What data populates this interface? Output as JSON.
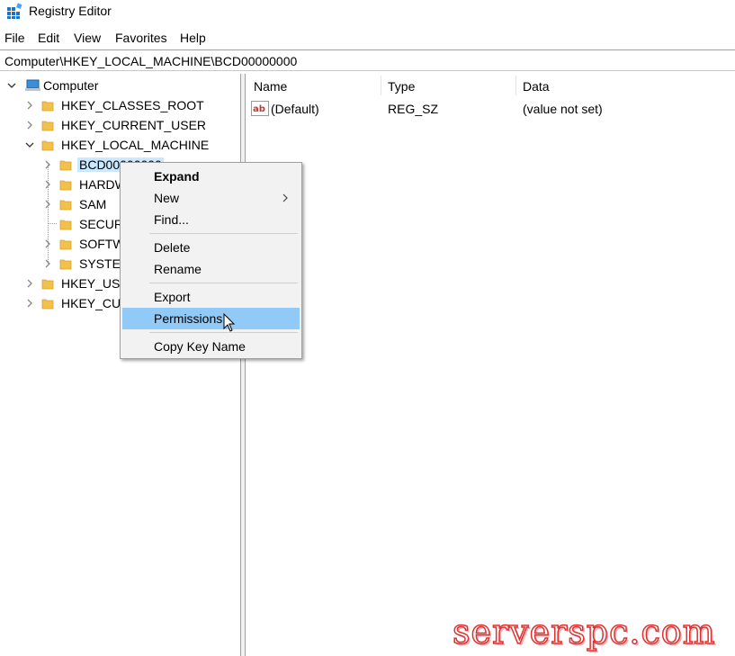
{
  "window": {
    "title": "Registry Editor"
  },
  "menu": [
    "File",
    "Edit",
    "View",
    "Favorites",
    "Help"
  ],
  "address": {
    "path": "Computer\\HKEY_LOCAL_MACHINE\\BCD00000000"
  },
  "tree": {
    "root": "Computer",
    "hkcr": "HKEY_CLASSES_ROOT",
    "hkcu": "HKEY_CURRENT_USER",
    "hklm": "HKEY_LOCAL_MACHINE",
    "bcd": "BCD00000000",
    "hardware": "HARDWARE",
    "sam": "SAM",
    "security": "SECURITY",
    "software": "SOFTWARE",
    "system": "SYSTEM",
    "hku": "HKEY_USERS",
    "hkcc": "HKEY_CURRENT_CONFIG"
  },
  "values": {
    "columns": {
      "name": "Name",
      "type": "Type",
      "data": "Data"
    },
    "rows": [
      {
        "name": "(Default)",
        "type": "REG_SZ",
        "data": "(value not set)",
        "icon": "string-value-icon"
      }
    ]
  },
  "context_menu": {
    "expand": "Expand",
    "new": "New",
    "find": "Find...",
    "delete": "Delete",
    "rename": "Rename",
    "export": "Export",
    "permissions": "Permissions...",
    "copy_key_name": "Copy Key Name",
    "highlighted": "Permissions..."
  },
  "watermark": "serverspc.com",
  "colors": {
    "selection": "#cce8ff",
    "menu_highlight": "#91c9f7",
    "folder": "#f2c04c",
    "watermark": "#e03030"
  }
}
